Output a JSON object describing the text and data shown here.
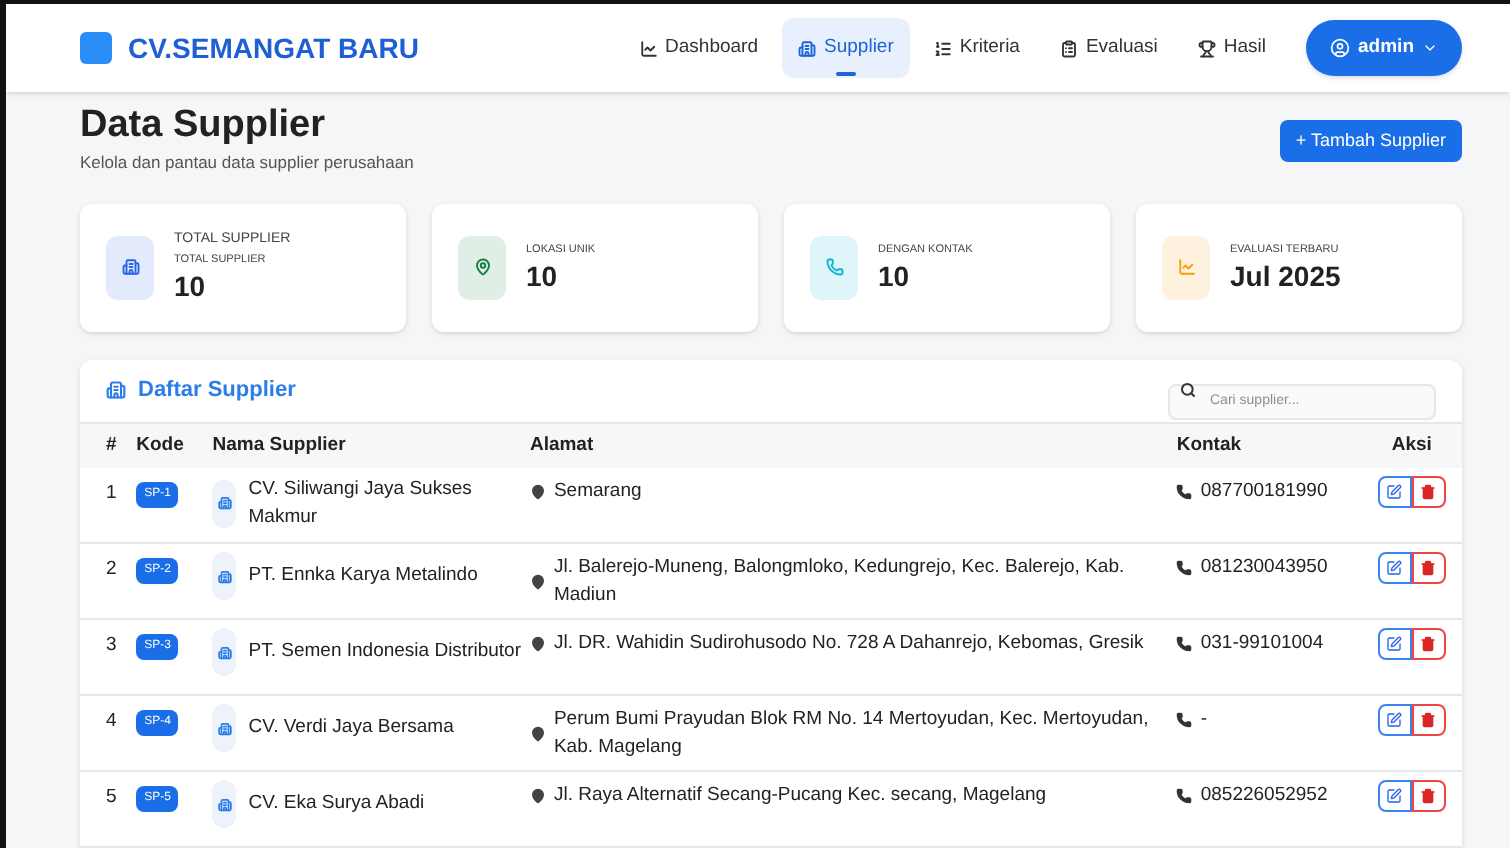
{
  "brand": "CV.SEMANGAT BARU",
  "nav": [
    {
      "label": "Dashboard",
      "kind": "chart",
      "selected": false
    },
    {
      "label": "Supplier",
      "kind": "building",
      "selected": true
    },
    {
      "label": "Kriteria",
      "kind": "list",
      "selected": false
    },
    {
      "label": "Evaluasi",
      "kind": "clipboard",
      "selected": false
    },
    {
      "label": "Hasil",
      "kind": "trophy",
      "selected": false
    }
  ],
  "user_menu": "admin",
  "page": {
    "title": "Data Supplier",
    "subtitle": "Kelola dan pantau data supplier perusahaan",
    "add_button": "+ Tambah Supplier"
  },
  "stats": [
    {
      "label": "TOTAL SUPPLIER",
      "sublabel": "TOTAL SUPPLIER",
      "value": "10",
      "kind": "building",
      "color": "#2563eb"
    },
    {
      "label": "LOKASI UNIK",
      "value": "10",
      "kind": "pin",
      "color": "#15803d"
    },
    {
      "label": "DENGAN KONTAK",
      "value": "10",
      "kind": "phone",
      "color": "#06b6d4"
    },
    {
      "label": "EVALUASI TERBARU",
      "value": "Jul 2025",
      "kind": "chart",
      "color": "#f59e0b"
    }
  ],
  "table": {
    "title": "Daftar Supplier",
    "search": {
      "placeholder": "Cari supplier..."
    },
    "columns": [
      "#",
      "Kode",
      "Nama Supplier",
      "Alamat",
      "Kontak",
      "Aksi"
    ],
    "rows": [
      {
        "no": "1",
        "code": "SP-1",
        "name": "CV. Siliwangi Jaya Sukses Makmur",
        "address": "Semarang",
        "contact": "087700181990"
      },
      {
        "no": "2",
        "code": "SP-2",
        "name": "PT. Ennka Karya Metalindo",
        "address": "Jl. Balerejo-Muneng, Balongmloko, Kedungrejo, Kec. Balerejo, Kab. Madiun",
        "contact": "081230043950"
      },
      {
        "no": "3",
        "code": "SP-3",
        "name": "PT. Semen Indonesia Distributor",
        "address": "Jl. DR. Wahidin Sudirohusodo No. 728 A Dahanrejo, Kebomas, Gresik",
        "contact": "031-99101004"
      },
      {
        "no": "4",
        "code": "SP-4",
        "name": "CV. Verdi Jaya Bersama",
        "address": "Perum Bumi Prayudan Blok RM No. 14 Mertoyudan, Kec. Mertoyudan, Kab. Magelang",
        "contact": "-"
      },
      {
        "no": "5",
        "code": "SP-5",
        "name": "CV. Eka Surya Abadi",
        "address": "Jl. Raya Alternatif Secang-Pucang Kec. secang, Magelang",
        "contact": "085226052952"
      }
    ]
  }
}
